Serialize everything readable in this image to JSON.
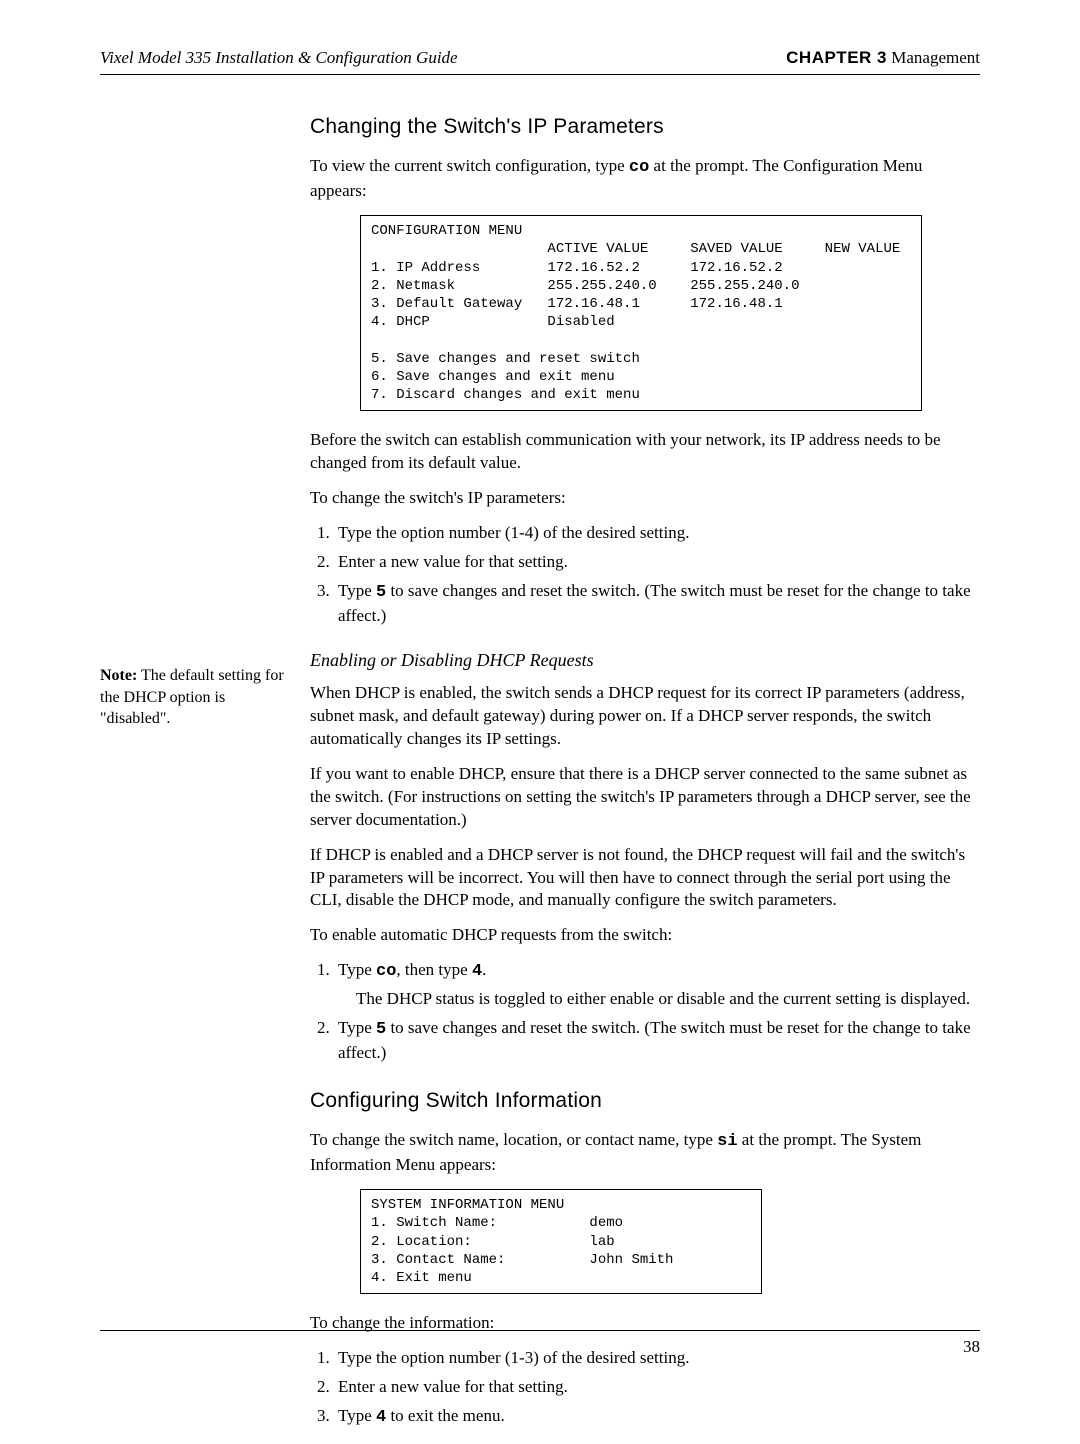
{
  "header": {
    "left": "Vixel Model 335 Installation & Configuration Guide",
    "chapter_label": "CHAPTER 3",
    "chapter_title": " Management"
  },
  "section1": {
    "title": "Changing the Switch's IP Parameters",
    "intro_a": "To view the current switch configuration, type ",
    "intro_cmd": "co",
    "intro_b": " at the prompt. The Configuration Menu appears:",
    "termbox": "CONFIGURATION MENU\n                     ACTIVE VALUE     SAVED VALUE     NEW VALUE\n1. IP Address        172.16.52.2      172.16.52.2\n2. Netmask           255.255.240.0    255.255.240.0\n3. Default Gateway   172.16.48.1      172.16.48.1\n4. DHCP              Disabled\n\n5. Save changes and reset switch\n6. Save changes and exit menu\n7. Discard changes and exit menu",
    "para2": "Before the switch can establish communication with your network, its IP address needs to be changed from its default value.",
    "para3": "To change the switch's IP parameters:",
    "steps": {
      "s1": "Type the option number (1-4) of the desired setting.",
      "s2": "Enter a new value for that setting.",
      "s3a": "Type ",
      "s3cmd": "5",
      "s3b": " to save changes and reset the switch. (The switch must be reset for the change to take affect.)"
    }
  },
  "section2": {
    "title": "Enabling or Disabling DHCP Requests",
    "para1": "When DHCP is enabled, the switch sends a DHCP request for its correct IP parameters (address, subnet mask, and default gateway) during power on. If a DHCP server responds, the switch automatically changes its IP settings.",
    "sidenote_bold": "Note:",
    "sidenote_rest": " The default setting for the DHCP option is \"disabled\".",
    "para2": "If you want to enable DHCP, ensure that there is a DHCP server connected to the same subnet as the switch. (For instructions on setting the switch's IP parameters through a DHCP server, see the server documentation.)",
    "para3": "If DHCP is enabled and a DHCP server is not found, the DHCP request will fail and the switch's IP parameters will be incorrect. You will then have to connect through the serial port using the CLI, disable the DHCP mode, and manually configure the switch parameters.",
    "para4": "To enable automatic DHCP requests from the switch:",
    "steps": {
      "s1a": "Type ",
      "s1cmd1": "co",
      "s1b": ", then type ",
      "s1cmd2": "4",
      "s1c": ".",
      "s1sub": "The DHCP status is toggled to either enable or disable and the current setting is displayed.",
      "s2a": "Type ",
      "s2cmd": "5",
      "s2b": " to save changes and reset the switch. (The switch must be reset for the change to take affect.)"
    }
  },
  "section3": {
    "title": "Configuring Switch Information",
    "intro_a": "To change the switch name, location, or contact name, type ",
    "intro_cmd": "si",
    "intro_b": " at the prompt. The System Information Menu appears:",
    "termbox": "SYSTEM INFORMATION MENU\n1. Switch Name:           demo\n2. Location:              lab\n3. Contact Name:          John Smith\n4. Exit menu",
    "para2": "To change the information:",
    "steps": {
      "s1": "Type the option number (1-3) of the desired setting.",
      "s2": "Enter a new value for that setting.",
      "s3a": "Type ",
      "s3cmd": "4",
      "s3b": " to exit the menu."
    }
  },
  "footer": {
    "page": "38"
  }
}
